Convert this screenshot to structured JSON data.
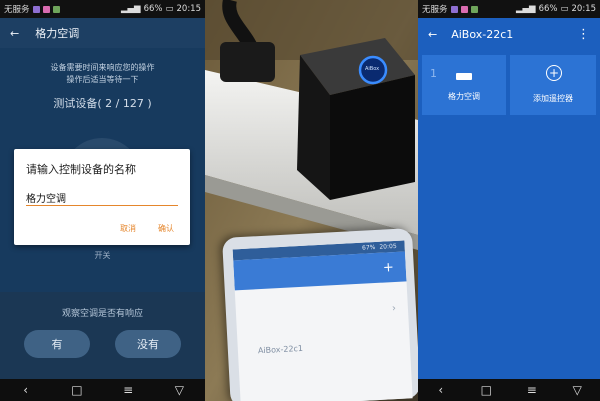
{
  "left_phone": {
    "statusbar": {
      "carrier": "无服务",
      "battery": "66%",
      "time": "20:15"
    },
    "header": {
      "back_icon": "←",
      "title": "格力空调"
    },
    "hint_lines": [
      "设备需要时间来响应您的操作",
      "操作后适当等待一下"
    ],
    "progress": "测试设备( 2 / 127 )",
    "switch_label": "开关",
    "question": "观察空调是否有响应",
    "yes_label": "有",
    "no_label": "没有",
    "dialog": {
      "title": "请输入控制设备的名称",
      "input_value": "格力空调",
      "cancel_label": "取消",
      "confirm_label": "确认"
    }
  },
  "photo": {
    "phone_screen": {
      "battery": "67%",
      "time": "20:05",
      "plus": "+",
      "list_item": "AiBox-22c1",
      "chevron": "›"
    },
    "device_logo_text": "AiBox"
  },
  "right_phone": {
    "statusbar": {
      "carrier": "无服务",
      "battery": "66%",
      "time": "20:15"
    },
    "header": {
      "back_icon": "←",
      "title": "AiBox-22c1",
      "menu_icon": "⋮"
    },
    "cards": [
      {
        "index": "1",
        "label": "格力空调",
        "icon": "ac-unit-icon"
      },
      {
        "label": "添加遥控器",
        "icon": "plus-circle-icon"
      }
    ]
  },
  "navbar": {
    "back": "‹",
    "home": "□",
    "menu": "≡",
    "notify": "▽"
  },
  "colors": {
    "left_bg": "#1d3f63",
    "accent_orange": "#e5862c",
    "right_bg": "#1c5fbe",
    "card_bg": "#2c73d4"
  }
}
